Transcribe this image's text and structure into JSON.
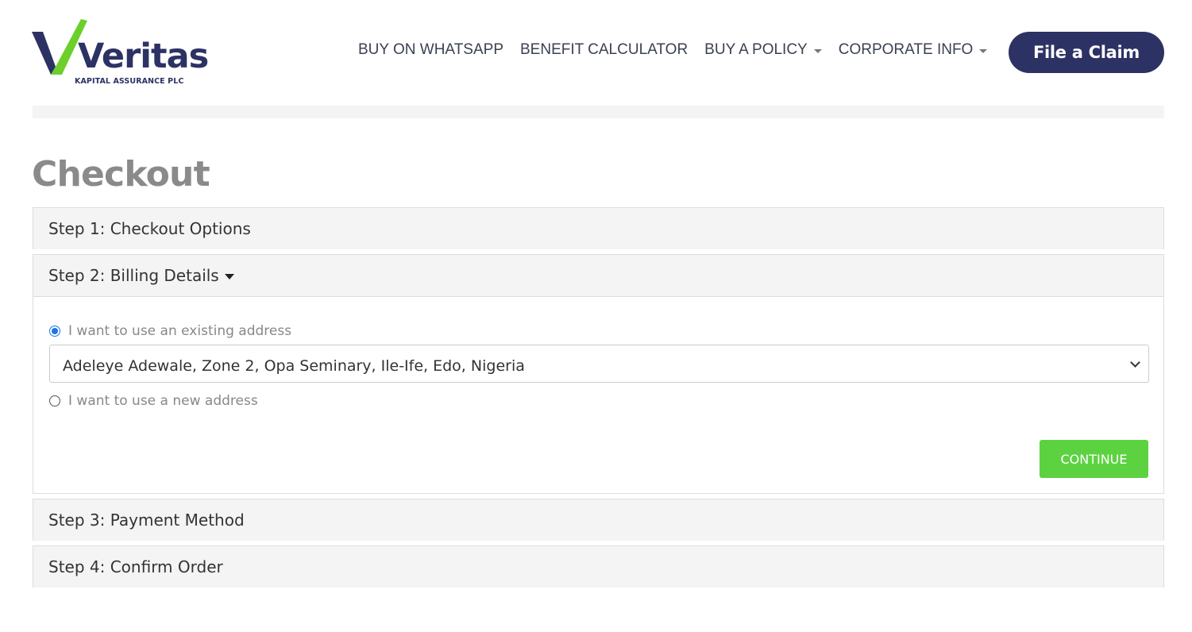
{
  "brand": {
    "logo_name": "Veritas",
    "logo_sub": "KAPITAL ASSURANCE PLC",
    "primary_color": "#2d3264",
    "accent_color": "#5dd241",
    "check_color": "#6ccf2a"
  },
  "nav": {
    "items": [
      {
        "label": "BUY ON WHATSAPP",
        "dropdown": false
      },
      {
        "label": "BENEFIT CALCULATOR",
        "dropdown": false
      },
      {
        "label": "BUY A POLICY",
        "dropdown": true
      },
      {
        "label": "CORPORATE INFO",
        "dropdown": true
      }
    ],
    "cta_label": "File a Claim"
  },
  "page": {
    "title": "Checkout"
  },
  "checkout": {
    "steps": [
      {
        "label": "Step 1: Checkout Options",
        "expanded": false
      },
      {
        "label": "Step 2: Billing Details",
        "expanded": true
      },
      {
        "label": "Step 3: Payment Method",
        "expanded": false
      },
      {
        "label": "Step 4: Confirm Order",
        "expanded": false
      }
    ],
    "billing": {
      "existing_label": "I want to use an existing address",
      "existing_selected": true,
      "address_value": "Adeleye Adewale, Zone 2, Opa Seminary, Ile-Ife, Edo, Nigeria",
      "new_label": "I want to use a new address",
      "continue_label": "CONTINUE"
    }
  }
}
